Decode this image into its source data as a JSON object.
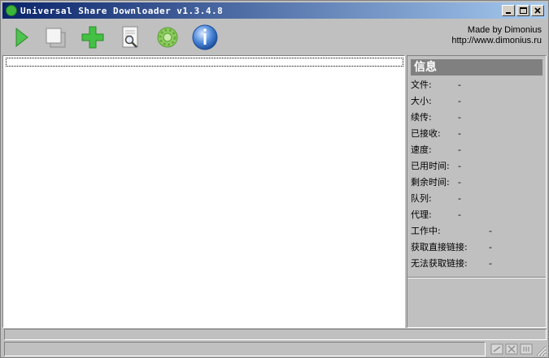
{
  "window": {
    "title": "Universal Share Downloader v1.3.4.8"
  },
  "toolbar": {
    "buttons": [
      {
        "name": "start",
        "icon": "play-icon"
      },
      {
        "name": "copy",
        "icon": "copy-icon"
      },
      {
        "name": "add",
        "icon": "plus-icon"
      },
      {
        "name": "search",
        "icon": "search-document-icon"
      },
      {
        "name": "settings",
        "icon": "gear-icon"
      },
      {
        "name": "about",
        "icon": "info-globe-icon"
      }
    ]
  },
  "credit": {
    "line1": "Made by Dimonius",
    "line2": "http://www.dimonius.ru"
  },
  "info": {
    "title": "信息",
    "rows": [
      {
        "label": "文件:",
        "value": "-"
      },
      {
        "label": "大小:",
        "value": "-"
      },
      {
        "label": "续传:",
        "value": "-"
      },
      {
        "label": "已接收:",
        "value": "-"
      },
      {
        "label": "速度:",
        "value": "-"
      },
      {
        "label": "已用时间:",
        "value": "-"
      },
      {
        "label": "剩余时间:",
        "value": "-"
      },
      {
        "label": "队列:",
        "value": "-"
      },
      {
        "label": "代理:",
        "value": "-"
      },
      {
        "label": "工作中:",
        "value": "-"
      },
      {
        "label": "获取直接链接:",
        "value": "-"
      },
      {
        "label": "无法获取链接:",
        "value": "-"
      }
    ]
  },
  "colors": {
    "face": "#c0c0c0",
    "title_start": "#0a246a",
    "title_end": "#a6caf0",
    "accent_green": "#3bb43b",
    "info_header": "#808080"
  }
}
